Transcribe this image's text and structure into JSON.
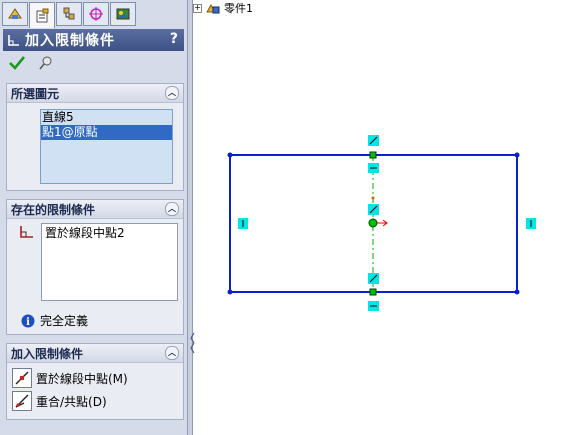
{
  "panel": {
    "title": "加入限制條件",
    "help": "?",
    "tabs": [
      "feature-manager-icon",
      "property-manager-icon",
      "configuration-manager-icon",
      "dimxpert-icon",
      "display-manager-icon"
    ]
  },
  "selected_entities": {
    "header": "所選圖元",
    "items": [
      "直線5",
      "點1@原點"
    ],
    "selected_index": 1
  },
  "existing_relations": {
    "header": "存在的限制條件",
    "items": [
      "置於線段中點2"
    ],
    "status": "完全定義"
  },
  "add_relations": {
    "header": "加入限制條件",
    "items": [
      {
        "label": "置於線段中點(M)",
        "icon": "midpoint-icon"
      },
      {
        "label": "重合/共點(D)",
        "icon": "coincident-icon"
      }
    ]
  },
  "tree": {
    "part_label": "零件1"
  },
  "colors": {
    "sketch_line": "#0a1fd0",
    "relation_marker": "#00e5e5",
    "centerline": "#00b000",
    "title_bar": "#3e5186"
  }
}
